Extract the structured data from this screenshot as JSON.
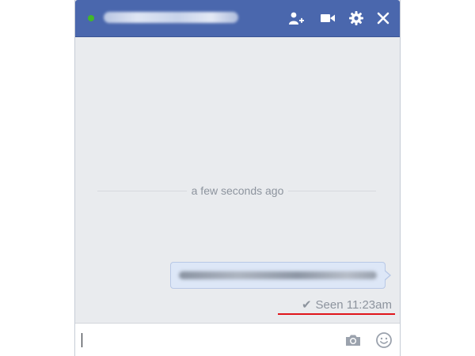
{
  "header": {
    "status": "online",
    "icons": [
      "add-friend-icon",
      "video-camera-icon",
      "gear-icon",
      "close-icon"
    ]
  },
  "conversation": {
    "timestamp": "a few seconds ago",
    "read_receipt": {
      "check": "✔",
      "text": "Seen 11:23am"
    }
  },
  "composer": {
    "icons": [
      "camera-icon",
      "emoji-icon"
    ]
  },
  "colors": {
    "header_bg": "#4a67ad",
    "presence": "#42b72a",
    "chat_bg": "#e9ebee",
    "bubble_bg": "#dde7f7",
    "highlight": "#e0151b"
  }
}
